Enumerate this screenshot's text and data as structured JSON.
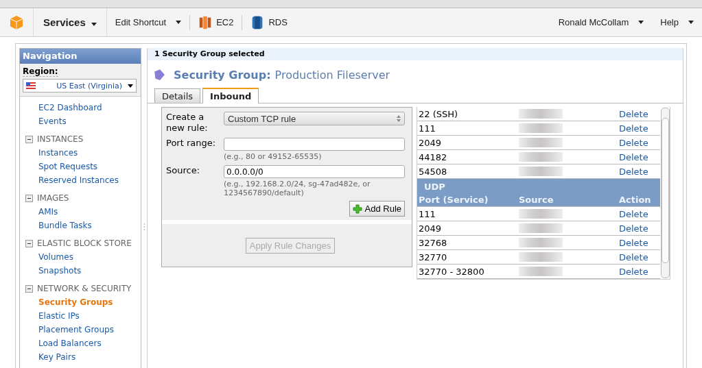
{
  "toolbar": {
    "services": "Services",
    "edit_shortcut": "Edit Shortcut",
    "shortcuts": [
      {
        "label": "EC2",
        "kind": "ec2"
      },
      {
        "label": "RDS",
        "kind": "rds"
      }
    ],
    "user": "Ronald McCollam",
    "help": "Help"
  },
  "navigation": {
    "title": "Navigation",
    "region_label": "Region:",
    "region": "US East (Virginia)",
    "sections": [
      {
        "items": [
          {
            "label": "EC2 Dashboard",
            "selected": false
          },
          {
            "label": "Events",
            "selected": false
          }
        ]
      },
      {
        "title": "INSTANCES",
        "expanded": true,
        "items": [
          {
            "label": "Instances",
            "selected": false
          },
          {
            "label": "Spot Requests",
            "selected": false
          },
          {
            "label": "Reserved Instances",
            "selected": false
          }
        ]
      },
      {
        "title": "IMAGES",
        "expanded": true,
        "items": [
          {
            "label": "AMIs",
            "selected": false
          },
          {
            "label": "Bundle Tasks",
            "selected": false
          }
        ]
      },
      {
        "title": "ELASTIC BLOCK STORE",
        "expanded": true,
        "items": [
          {
            "label": "Volumes",
            "selected": false
          },
          {
            "label": "Snapshots",
            "selected": false
          }
        ]
      },
      {
        "title": "NETWORK & SECURITY",
        "expanded": true,
        "items": [
          {
            "label": "Security Groups",
            "selected": true
          },
          {
            "label": "Elastic IPs",
            "selected": false
          },
          {
            "label": "Placement Groups",
            "selected": false
          },
          {
            "label": "Load Balancers",
            "selected": false
          },
          {
            "label": "Key Pairs",
            "selected": false
          }
        ]
      }
    ]
  },
  "selection_bar": "1 Security Group selected",
  "heading": {
    "label": "Security Group:",
    "name": "Production Fileserver"
  },
  "tabs": [
    {
      "label": "Details",
      "selected": false
    },
    {
      "label": "Inbound",
      "selected": true
    }
  ],
  "form": {
    "rule_label": "Create a new rule:",
    "rule_value": "Custom TCP rule",
    "port_label": "Port range:",
    "port_hint": "(e.g., 80 or 49152-65535)",
    "source_label": "Source:",
    "source_value": "0.0.0.0/0",
    "source_hint": "(e.g., 192.168.2.0/24, sg-47ad482e, or 1234567890/default)",
    "add_button": "Add Rule",
    "apply_button": "Apply Rule Changes",
    "apply_disabled": true
  },
  "rules": [
    {
      "kind": "row",
      "port": "22 (SSH)",
      "action": "Delete"
    },
    {
      "kind": "row",
      "port": "111",
      "action": "Delete"
    },
    {
      "kind": "row",
      "port": "2049",
      "action": "Delete"
    },
    {
      "kind": "row",
      "port": "44182",
      "action": "Delete"
    },
    {
      "kind": "row",
      "port": "54508",
      "action": "Delete"
    },
    {
      "kind": "group",
      "protocol": "UDP",
      "columns": [
        "Port (Service)",
        "Source",
        "Action"
      ]
    },
    {
      "kind": "row",
      "port": "111",
      "action": "Delete"
    },
    {
      "kind": "row",
      "port": "2049",
      "action": "Delete"
    },
    {
      "kind": "row",
      "port": "32768",
      "action": "Delete"
    },
    {
      "kind": "row",
      "port": "32770",
      "action": "Delete"
    },
    {
      "kind": "row",
      "port": "32770 - 32800",
      "action": "Delete"
    }
  ]
}
